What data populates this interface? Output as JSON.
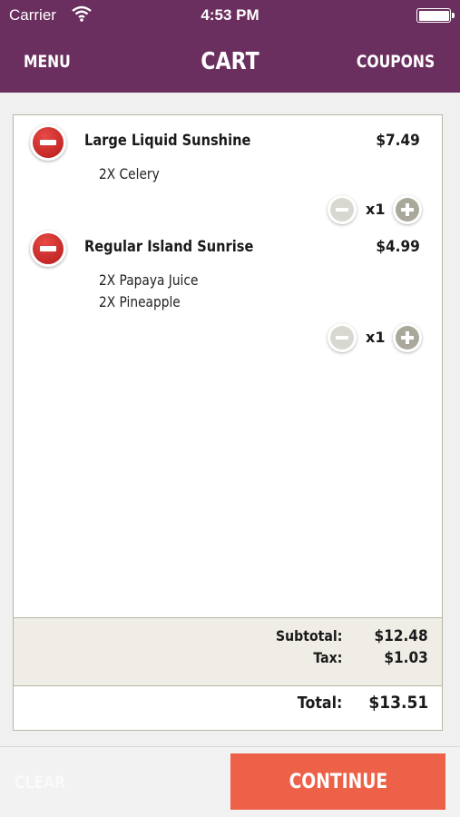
{
  "status_bar": {
    "carrier": "Carrier",
    "time": "4:53 PM"
  },
  "nav": {
    "menu_label": "MENU",
    "title": "CART",
    "coupons_label": "COUPONS"
  },
  "items": [
    {
      "name": "Large  Liquid Sunshine",
      "price": "$7.49",
      "modifiers": [
        "2X Celery"
      ],
      "quantity": "x1"
    },
    {
      "name": "Regular  Island Sunrise",
      "price": "$4.99",
      "modifiers": [
        "2X Papaya Juice",
        "2X Pineapple"
      ],
      "quantity": "x1"
    }
  ],
  "summary": {
    "subtotal_label": "Subtotal:",
    "subtotal_value": "$12.48",
    "tax_label": "Tax:",
    "tax_value": "$1.03",
    "total_label": "Total:",
    "total_value": "$13.51"
  },
  "footer": {
    "clear_label": "CLEAR",
    "continue_label": "CONTINUE"
  },
  "colors": {
    "header": "#6a2f5e",
    "continue": "#ee6149",
    "remove": "#c8201f"
  }
}
